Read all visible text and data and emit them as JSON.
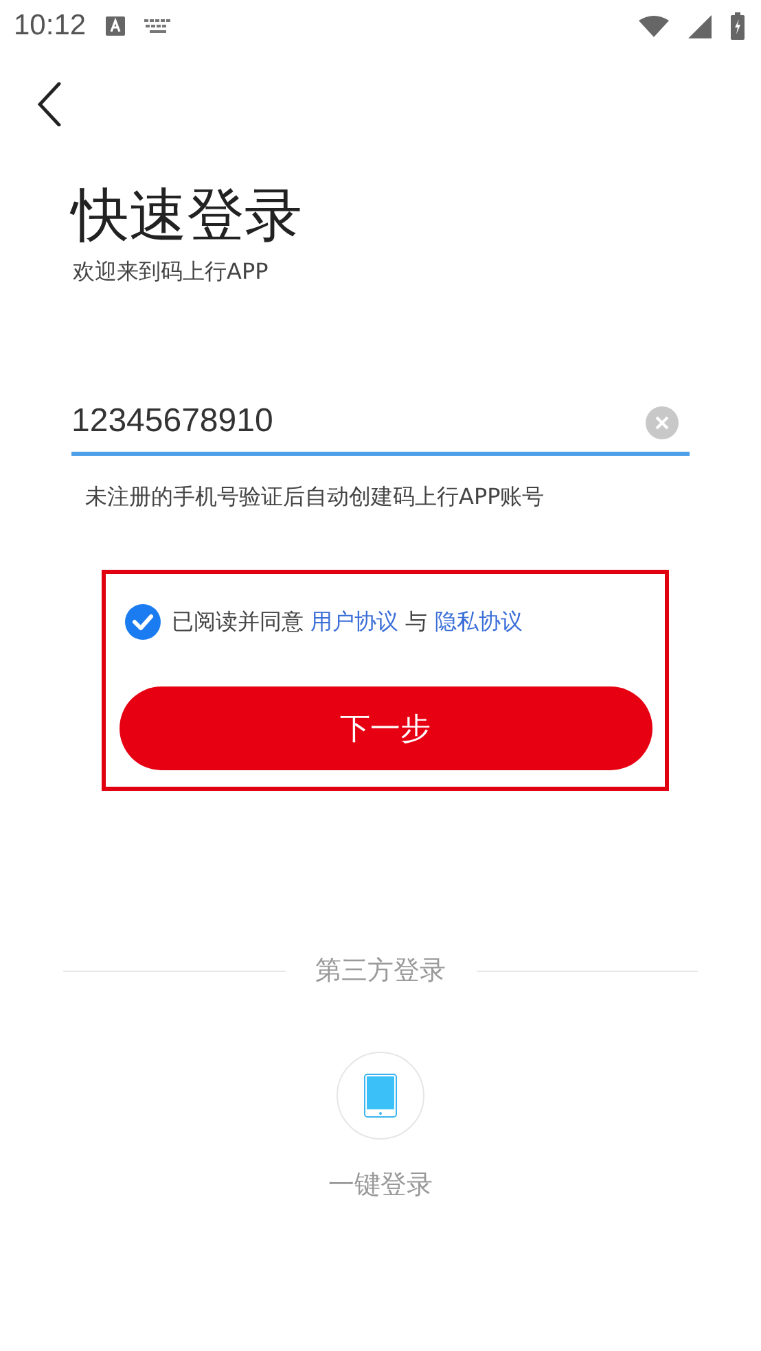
{
  "status_bar": {
    "time": "10:12"
  },
  "title": "快速登录",
  "subtitle": "欢迎来到码上行APP",
  "phone_field": {
    "value": "12345678910"
  },
  "hint": "未注册的手机号验证后自动创建码上行APP账号",
  "agreement": {
    "checked": true,
    "parts": [
      {
        "kind": "text",
        "text": "已阅读并同意 "
      },
      {
        "kind": "link",
        "text": "用户协议"
      },
      {
        "kind": "text",
        "text": " 与 "
      },
      {
        "kind": "link",
        "text": "隐私协议"
      }
    ]
  },
  "highlight": true,
  "next_button": {
    "label": "下一步"
  },
  "divider_label": "第三方登录",
  "quick_login": {
    "label": "一键登录"
  }
}
